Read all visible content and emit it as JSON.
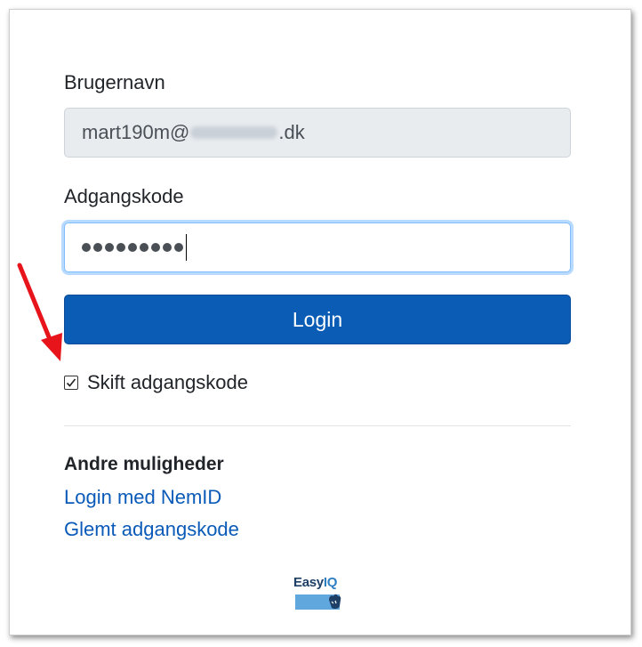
{
  "form": {
    "username_label": "Brugernavn",
    "username_value_prefix": "mart190m@",
    "username_value_suffix": ".dk",
    "password_label": "Adgangskode",
    "password_dots": 9,
    "login_button": "Login",
    "change_password_checkbox": {
      "label": "Skift adgangskode",
      "checked": true
    }
  },
  "other_options": {
    "heading": "Andre muligheder",
    "links": [
      "Login med NemID",
      "Glemt adgangskode"
    ]
  },
  "logo": {
    "text_part1": "Easy",
    "text_part2": "IQ"
  },
  "colors": {
    "primary_button": "#0b5cb5",
    "link": "#0a5ab8",
    "annotation_arrow": "#e8141c"
  },
  "icons": {
    "checkbox": "check-icon",
    "annotation": "red-arrow-icon"
  }
}
